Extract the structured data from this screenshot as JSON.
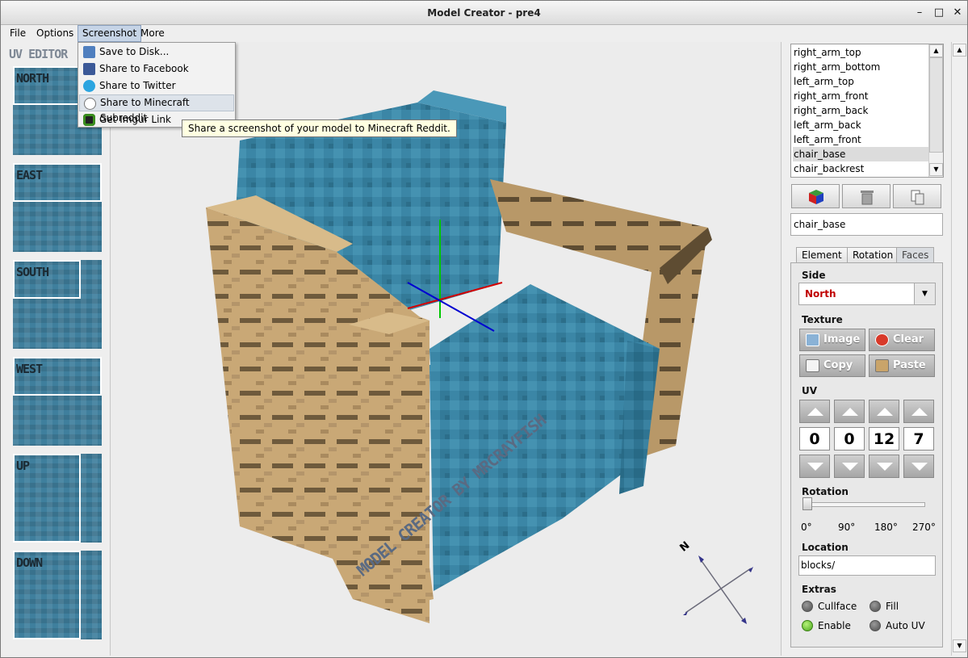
{
  "window": {
    "title": "Model Creator - pre4",
    "minimize_glyph": "–",
    "maximize_glyph": "□",
    "close_glyph": "✕"
  },
  "menubar": {
    "items": [
      "File",
      "Options",
      "Screenshot",
      "More"
    ],
    "active": "Screenshot"
  },
  "screenshot_menu": {
    "items": [
      {
        "label": "Save to Disk...",
        "icon": "floppy-disk-icon",
        "color": "#4f7fbf"
      },
      {
        "label": "Share to Facebook",
        "icon": "facebook-icon",
        "color": "#3b5998"
      },
      {
        "label": "Share to Twitter",
        "icon": "twitter-icon",
        "color": "#2ca5e0"
      },
      {
        "label": "Share to Minecraft Subreddit",
        "icon": "reddit-icon",
        "color": "#777777"
      },
      {
        "label": "Get Imgur Link",
        "icon": "imgur-icon",
        "color": "#3b8f1e"
      }
    ],
    "hovered_index": 3,
    "tooltip": "Share a screenshot of your model to Minecraft Reddit."
  },
  "uv_editor": {
    "title": "UV EDITOR",
    "faces": [
      "NORTH",
      "EAST",
      "SOUTH",
      "WEST",
      "UP",
      "DOWN"
    ]
  },
  "viewport": {
    "watermark": "MODEL CREATOR BY MRCRAYFISH",
    "compass_label": "N",
    "axis_colors": {
      "x": "#d40000",
      "y": "#00c800",
      "z": "#0000d0"
    },
    "fabric_color": "#3b86a6",
    "wood_color": "#c9a876",
    "wood_dark": "#6e5a3c"
  },
  "elements": {
    "items": [
      "right_arm_top",
      "right_arm_bottom",
      "left_arm_top",
      "right_arm_front",
      "right_arm_back",
      "left_arm_back",
      "left_arm_front",
      "chair_base",
      "chair_backrest"
    ],
    "selected_index": 7
  },
  "toolbar": {
    "add_icon": "cube-icon",
    "delete_icon": "trash-icon",
    "duplicate_icon": "copy-icon"
  },
  "name_field": {
    "value": "chair_base"
  },
  "tabs": {
    "items": [
      "Element",
      "Rotation",
      "Faces"
    ],
    "active": "Faces"
  },
  "faces_tab": {
    "side_label": "Side",
    "side_value": "North",
    "texture_label": "Texture",
    "buttons": {
      "image": "Image",
      "clear": "Clear",
      "copy": "Copy",
      "paste": "Paste"
    },
    "uv_label": "UV",
    "uv_values": [
      "0",
      "0",
      "12",
      "7"
    ],
    "rotation_label": "Rotation",
    "rotation_ticks": [
      "0°",
      "90°",
      "180°",
      "270°"
    ],
    "rotation_value_deg": 0,
    "location_label": "Location",
    "location_value": "blocks/",
    "extras_label": "Extras",
    "extras": [
      {
        "label": "Cullface",
        "on": false
      },
      {
        "label": "Fill",
        "on": false
      },
      {
        "label": "Enable",
        "on": true
      },
      {
        "label": "Auto UV",
        "on": false
      }
    ]
  }
}
